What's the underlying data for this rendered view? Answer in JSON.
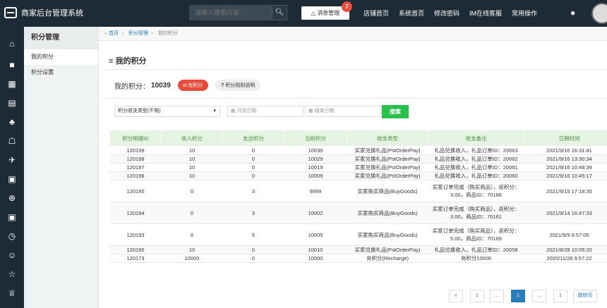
{
  "header": {
    "app_title": "商家后台管理系统",
    "search_placeholder": "请输入搜索内容...",
    "msg_label": "消息管理",
    "msg_count": "7",
    "nav": [
      "店铺首页",
      "系统首页",
      "修改密码",
      "IM在线客服",
      "常用操作"
    ]
  },
  "sidebar": {
    "title": "积分管理",
    "items": [
      {
        "label": "我的积分",
        "active": true
      },
      {
        "label": "积分设置",
        "active": false
      }
    ]
  },
  "breadcrumb": {
    "home": "首页",
    "section": "积分管理",
    "current": "我的积分"
  },
  "page": {
    "title": "我的积分",
    "points_label": "我的积分：",
    "points_value": "10039",
    "recharge_label": "充积分",
    "rules_label": "积分规则说明"
  },
  "filter": {
    "type_select": "积分收支类型(不限)",
    "start_date": "开始日期",
    "end_date": "结束日期",
    "search_label": "搜索"
  },
  "table": {
    "headers": [
      "积分明细ID",
      "收入积分",
      "支出积分",
      "当前积分",
      "收支类型",
      "收支备注",
      "日期时间"
    ],
    "rows": [
      [
        "120199",
        "10",
        "0",
        "10039",
        "买家兑换礼品(PstOrderPay)",
        "礼品兑换收入，礼品订单ID：20063",
        "2021/9/16 16:31:41"
      ],
      [
        "120198",
        "10",
        "0",
        "10029",
        "买家兑换礼品(PstOrderPay)",
        "礼品兑换收入，礼品订单ID：20062",
        "2021/9/16 13:30:34"
      ],
      [
        "120197",
        "10",
        "0",
        "10019",
        "买家兑换礼品(PstOrderPay)",
        "礼品兑换收入，礼品订单ID：20061",
        "2021/9/16 10:48:39"
      ],
      [
        "120196",
        "10",
        "0",
        "10009",
        "买家兑换礼品(PstOrderPay)",
        "礼品兑换收入，礼品订单ID：20060",
        "2021/9/16 10:45:17"
      ],
      [
        "120195",
        "0",
        "3",
        "9999",
        "买家购买商品(BuyGoods)",
        "买家订单完成（购买商品），返积分：3.00，商品ID：70166",
        "2021/9/15 17:18:35"
      ],
      [
        "120194",
        "0",
        "3",
        "10002",
        "买家购买商品(BuyGoods)",
        "买家订单完成（购买商品），返积分：3.00，商品ID：70161",
        "2021/9/14 16:47:33"
      ],
      [
        "120193",
        "0",
        "5",
        "10005",
        "买家购买商品(BuyGoods)",
        "买家订单完成（购买商品），返积分：5.00，商品ID：70169",
        "2021/9/9 6:57:05"
      ],
      [
        "120190",
        "10",
        "0",
        "10010",
        "买家兑换礼品(PstOrderPay)",
        "礼品兑换收入，礼品订单ID：20058",
        "2021/8/28 10:05:20"
      ],
      [
        "120173",
        "10000",
        "0",
        "10000",
        "充积分(Recharge)",
        "充积分10000",
        "2020/11/28 9:57:22"
      ]
    ]
  },
  "pagination": {
    "prev": "«",
    "items": [
      "1",
      "...",
      "1",
      "...",
      "1"
    ],
    "jump_label": "跳转页"
  }
}
